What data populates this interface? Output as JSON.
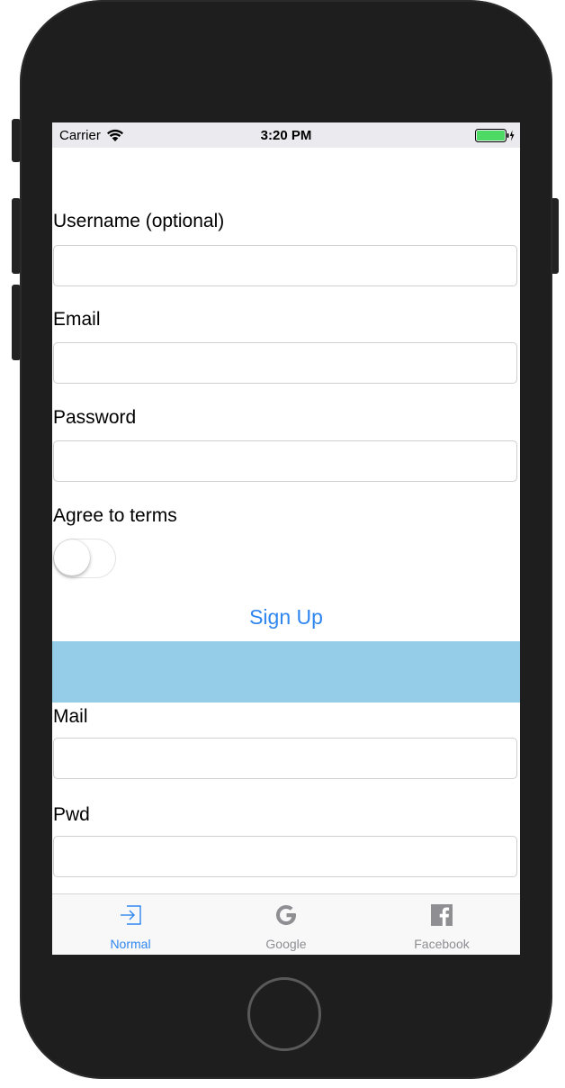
{
  "status_bar": {
    "carrier": "Carrier",
    "time": "3:20 PM",
    "icons": [
      "wifi-icon",
      "battery-icon",
      "charging-bolt-icon"
    ],
    "battery_color": "#4cd964"
  },
  "form": {
    "username_label": "Username (optional)",
    "username_value": "",
    "email_label": "Email",
    "email_value": "",
    "password_label": "Password",
    "password_value": "",
    "terms_label": "Agree to terms",
    "terms_toggle_on": false,
    "signup_label": "Sign Up"
  },
  "login_form": {
    "mail_label": "Mail",
    "mail_value": "",
    "pwd_label": "Pwd",
    "pwd_value": ""
  },
  "tabs": [
    {
      "label": "Normal",
      "icon": "sign-in-icon",
      "active": true
    },
    {
      "label": "Google",
      "icon": "google-icon",
      "active": false
    },
    {
      "label": "Facebook",
      "icon": "facebook-icon",
      "active": false
    }
  ],
  "colors": {
    "accent": "#2f86f0",
    "band": "#95cde8",
    "inactive_tab": "#8e8e93",
    "device_body": "#1e1e1e"
  }
}
